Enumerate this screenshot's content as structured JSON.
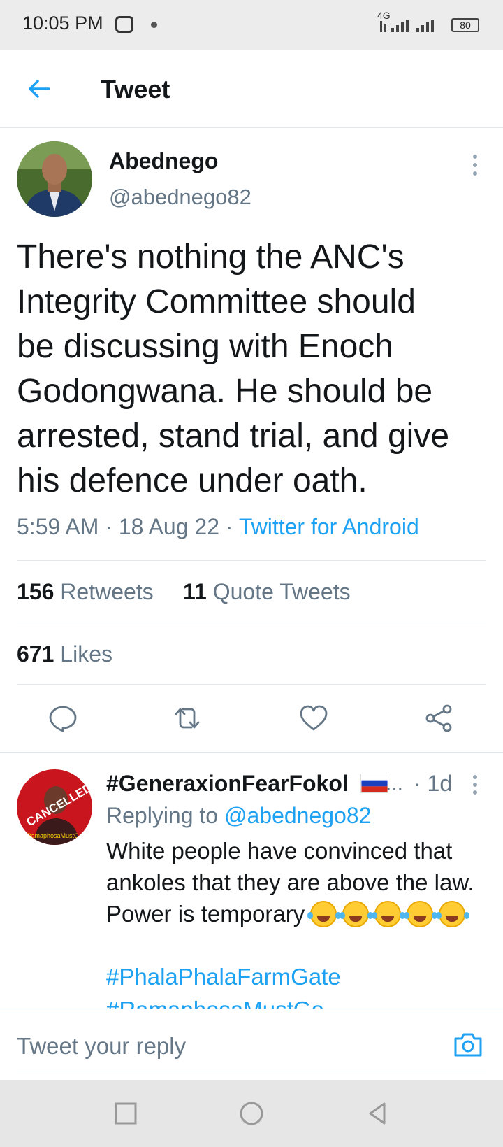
{
  "status_bar": {
    "time": "10:05 PM",
    "network": "4G",
    "battery": "80"
  },
  "header": {
    "title": "Tweet",
    "back_icon": "arrow-left-icon"
  },
  "tweet": {
    "author_name": "Abednego",
    "author_handle": "@abednego82",
    "text": "There's nothing the ANC's\nIntegrity Committee should\nbe discussing with Enoch\nGodongwana. He should be\narrested, stand trial, and give\nhis defence under oath.",
    "time": "5:59 AM",
    "date": "18 Aug 22",
    "source": "Twitter for Android",
    "retweets_count": "156",
    "retweets_label": "Retweets",
    "quotes_count": "11",
    "quotes_label": "Quote Tweets",
    "likes_count": "671",
    "likes_label": "Likes",
    "actions": [
      "reply-icon",
      "retweet-icon",
      "like-icon",
      "share-icon"
    ]
  },
  "reply": {
    "author_name": "#GeneraxionFearFokol",
    "ellipsis": "...",
    "time": "· 1d",
    "replying_prefix": "Replying to",
    "replying_handle": "@abednego82",
    "text_lines": [
      "White people have convinced that",
      "ankoles that they are above the law.",
      "Power is temporary"
    ],
    "emoji_count": 5,
    "hashtags": [
      "#PhalaPhalaFarmGate",
      "#RamaphosaMustGo"
    ],
    "avatar_text": "CANCELLED",
    "avatar_subtext": "RamaphosaMustGo"
  },
  "reply_bar": {
    "placeholder": "Tweet your reply"
  },
  "colors": {
    "accent": "#1da1f2",
    "secondary_text": "#657786",
    "divider": "#e1e8ed"
  }
}
